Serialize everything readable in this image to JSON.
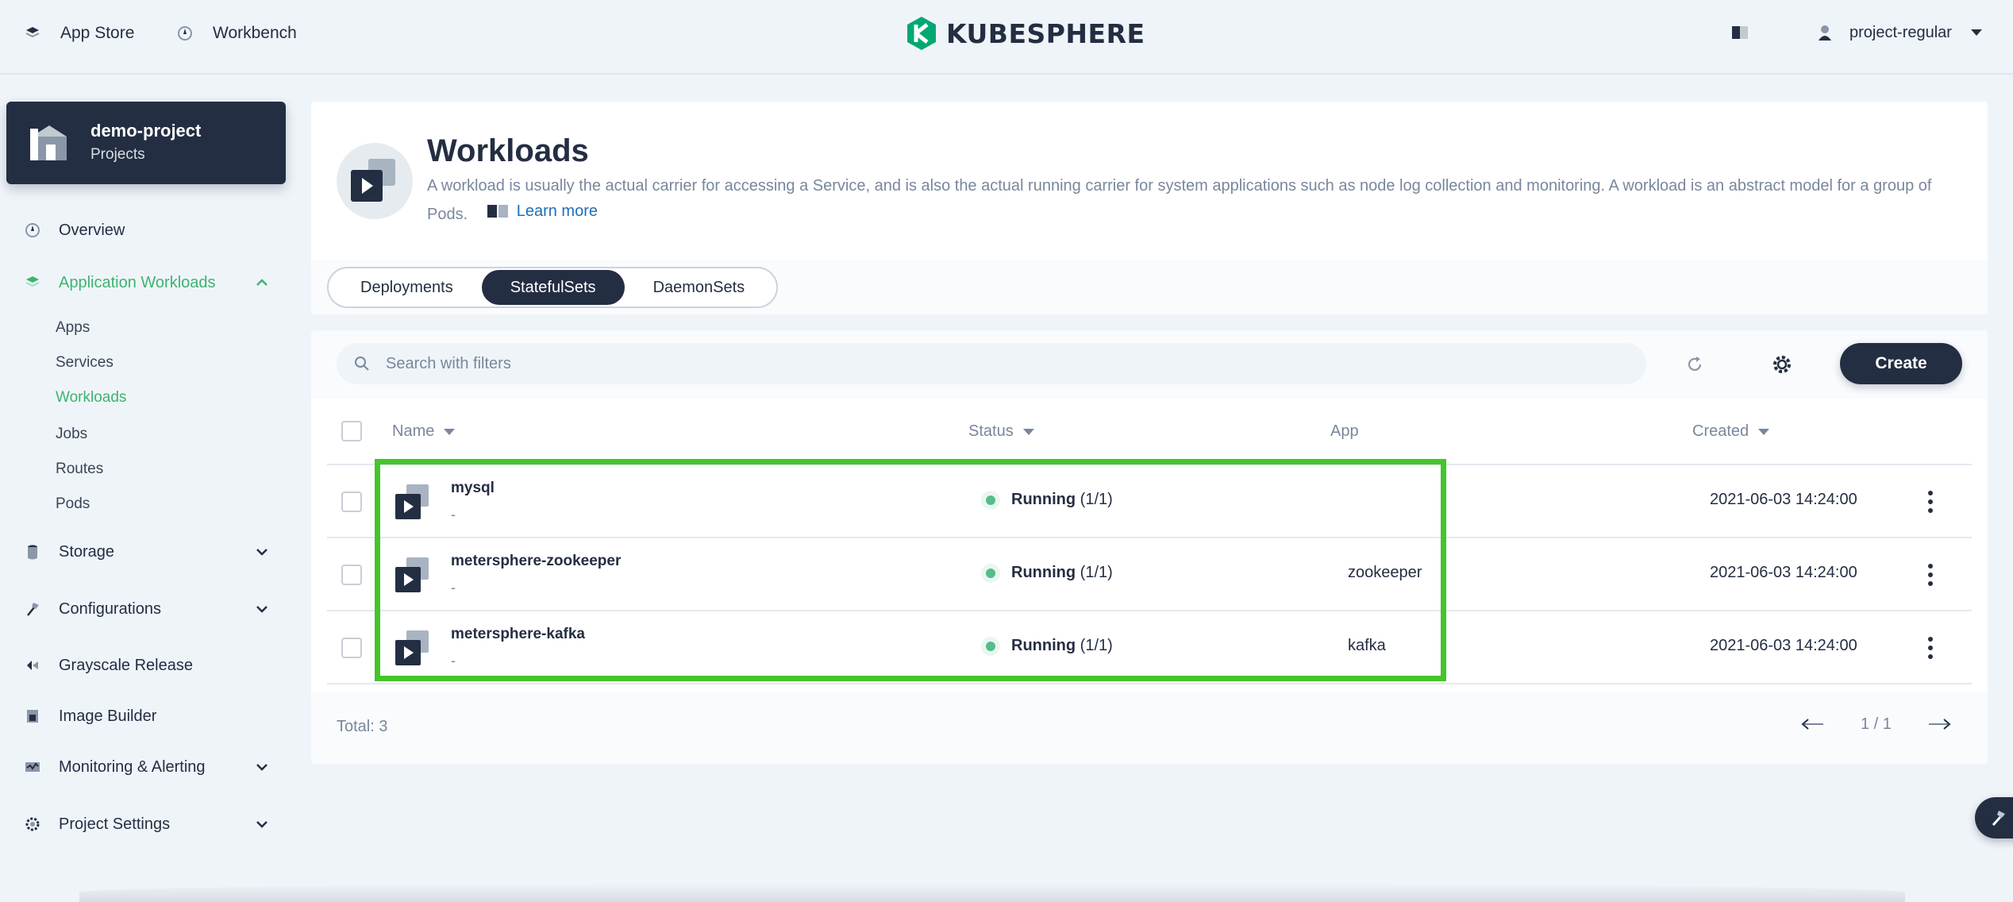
{
  "topbar": {
    "app_store": "App Store",
    "workbench": "Workbench",
    "logo_text": "KUBESPHERE",
    "username": "project-regular"
  },
  "project": {
    "name": "demo-project",
    "type": "Projects"
  },
  "sidebar": {
    "overview": "Overview",
    "application_workloads": "Application Workloads",
    "sub_items": [
      "Apps",
      "Services",
      "Workloads",
      "Jobs",
      "Routes",
      "Pods"
    ],
    "storage": "Storage",
    "configurations": "Configurations",
    "grayscale_release": "Grayscale Release",
    "image_builder": "Image Builder",
    "monitoring_alerting": "Monitoring & Alerting",
    "project_settings": "Project Settings"
  },
  "header": {
    "title": "Workloads",
    "description": "A workload is usually the actual carrier for accessing a Service, and is also the actual running carrier for system applications such as node log collection and monitoring. A workload is an abstract model for a group of Pods.",
    "learn_more": "Learn more"
  },
  "tabs": [
    "Deployments",
    "StatefulSets",
    "DaemonSets"
  ],
  "active_tab": "StatefulSets",
  "search": {
    "placeholder": "Search with filters"
  },
  "create_label": "Create",
  "table": {
    "columns": {
      "name": "Name",
      "status": "Status",
      "app": "App",
      "created": "Created"
    },
    "rows": [
      {
        "name": "mysql",
        "sub": "-",
        "status_label": "Running",
        "status_count": "(1/1)",
        "app": "",
        "created": "2021-06-03 14:24:00"
      },
      {
        "name": "metersphere-zookeeper",
        "sub": "-",
        "status_label": "Running",
        "status_count": "(1/1)",
        "app": "zookeeper",
        "created": "2021-06-03 14:24:00"
      },
      {
        "name": "metersphere-kafka",
        "sub": "-",
        "status_label": "Running",
        "status_count": "(1/1)",
        "app": "kafka",
        "created": "2021-06-03 14:24:00"
      }
    ]
  },
  "footer": {
    "total": "Total: 3",
    "page": "1 / 1"
  },
  "colors": {
    "accent_green": "#3eb370",
    "dark": "#242e42",
    "highlight": "#43c52b",
    "status_running": "#55bc8a"
  }
}
